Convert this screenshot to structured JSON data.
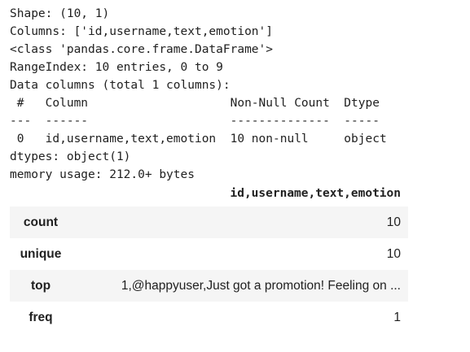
{
  "console_lines": [
    "Shape: (10, 1)",
    "Columns: ['id,username,text,emotion']",
    "<class 'pandas.core.frame.DataFrame'>",
    "RangeIndex: 10 entries, 0 to 9",
    "Data columns (total 1 columns):",
    " #   Column                    Non-Null Count  Dtype ",
    "---  ------                    --------------  ----- ",
    " 0   id,username,text,emotion  10 non-null     object",
    "dtypes: object(1)",
    "memory usage: 212.0+ bytes"
  ],
  "describe_table": {
    "column_header": "id,username,text,emotion",
    "rows": [
      {
        "label": "count",
        "value": "10"
      },
      {
        "label": "unique",
        "value": "10"
      },
      {
        "label": "top",
        "value": "1,@happyuser,Just got a promotion! Feeling on ..."
      },
      {
        "label": "freq",
        "value": "1"
      }
    ]
  }
}
